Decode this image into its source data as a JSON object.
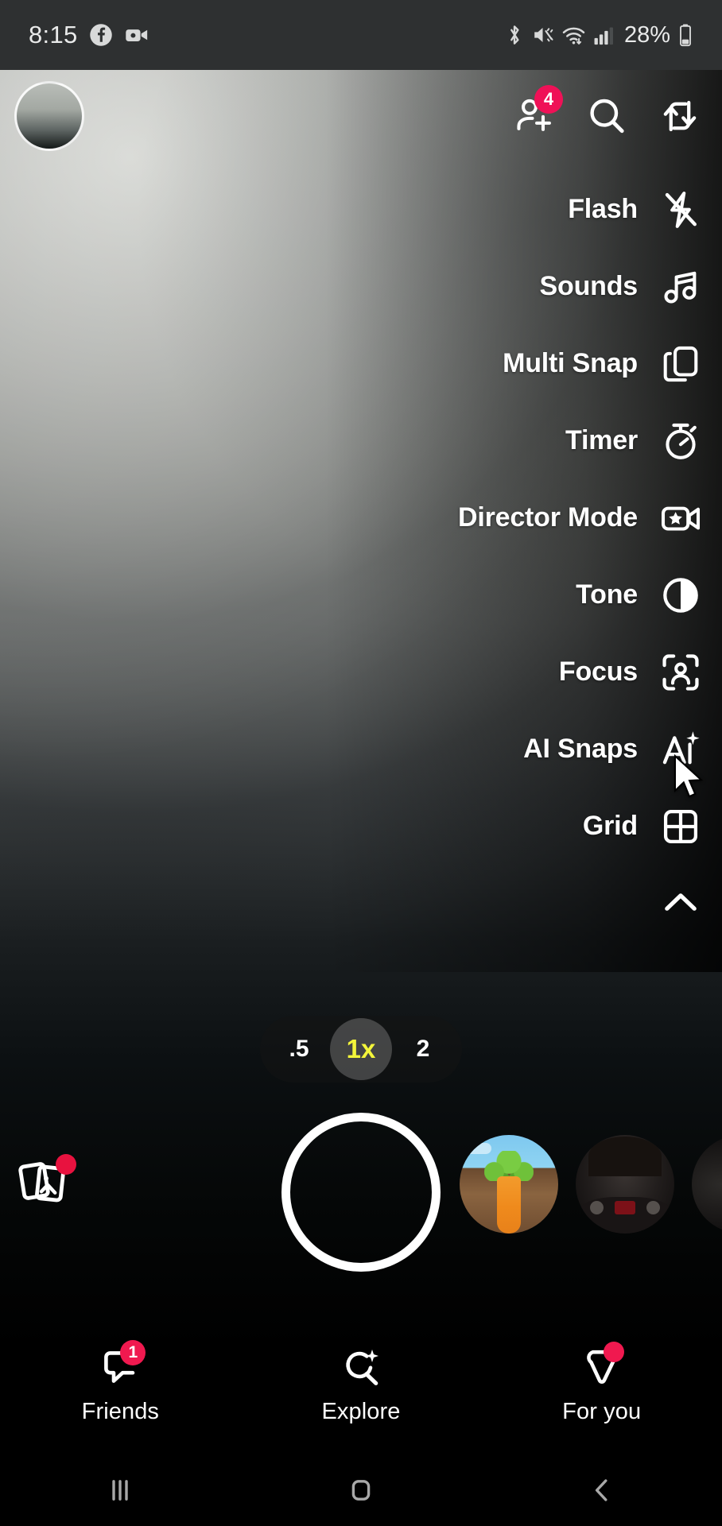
{
  "status_bar": {
    "time": "8:15",
    "battery_percent": "28%",
    "icons": [
      "facebook-icon",
      "video-camera-icon",
      "bluetooth-icon",
      "vibrate-mute-icon",
      "wifi-icon",
      "cellular-signal-icon",
      "battery-icon"
    ]
  },
  "top_bar": {
    "avatar_name": "profile-avatar",
    "add_friend_badge": "4",
    "actions": [
      {
        "name": "add-friend-icon"
      },
      {
        "name": "search-icon"
      },
      {
        "name": "flip-camera-icon"
      }
    ]
  },
  "side_menu": {
    "items": [
      {
        "label": "Flash",
        "icon": "flash-off-icon"
      },
      {
        "label": "Sounds",
        "icon": "music-note-icon"
      },
      {
        "label": "Multi Snap",
        "icon": "multi-snap-icon"
      },
      {
        "label": "Timer",
        "icon": "stopwatch-icon"
      },
      {
        "label": "Director Mode",
        "icon": "director-mode-icon"
      },
      {
        "label": "Tone",
        "icon": "contrast-icon"
      },
      {
        "label": "Focus",
        "icon": "focus-person-icon"
      },
      {
        "label": "AI Snaps",
        "icon": "ai-sparkle-icon"
      },
      {
        "label": "Grid",
        "icon": "grid-icon"
      }
    ],
    "collapse_icon": "chevron-up-icon"
  },
  "zoom_control": {
    "options": [
      {
        "value": ".5",
        "active": false
      },
      {
        "value": "1x",
        "active": true
      },
      {
        "value": "2",
        "active": false
      }
    ],
    "active_color": "#f3f53a"
  },
  "capture": {
    "shutter_name": "shutter-button",
    "memories_icon": "memories-icon",
    "memories_has_dot": true,
    "lenses": [
      {
        "name": "lens-carrot-thumbnail"
      },
      {
        "name": "lens-face-thumbnail"
      },
      {
        "name": "lens-partial-thumbnail"
      }
    ]
  },
  "bottom_nav": {
    "items": [
      {
        "label": "Friends",
        "icon": "chat-bubble-icon",
        "badge": "1"
      },
      {
        "label": "Explore",
        "icon": "explore-sparkle-icon",
        "badge": ""
      },
      {
        "label": "For you",
        "icon": "for-you-icon",
        "badge": ""
      }
    ]
  },
  "android_nav": {
    "items": [
      {
        "name": "recents-icon"
      },
      {
        "name": "home-icon"
      },
      {
        "name": "back-icon"
      }
    ]
  },
  "colors": {
    "accent_red": "#ef1157",
    "accent_yellow": "#f3f53a",
    "status_bar_bg": "#2e3031"
  }
}
